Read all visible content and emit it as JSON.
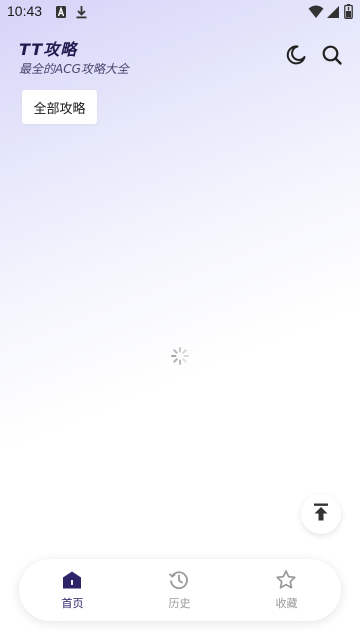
{
  "status_bar": {
    "time": "10:43",
    "left_icons": [
      "a-notification-icon",
      "download-icon"
    ],
    "right_icons": [
      "wifi-icon",
      "cellular-signal-icon",
      "battery-icon"
    ]
  },
  "header": {
    "title": "TT攻略",
    "subtitle": "最全的ACG攻略大全",
    "actions": [
      "dark-mode-moon-icon",
      "search-icon"
    ]
  },
  "filter": {
    "selected_label": "全部攻略"
  },
  "content": {
    "loading": true
  },
  "bottom_nav": {
    "items": [
      {
        "label": "首页",
        "icon": "home-icon",
        "active": true
      },
      {
        "label": "历史",
        "icon": "history-icon",
        "active": false
      },
      {
        "label": "收藏",
        "icon": "star-icon",
        "active": false
      }
    ]
  },
  "colors": {
    "accent": "#2c2466",
    "inactive": "#9a9a9a",
    "title": "#231a4f"
  }
}
